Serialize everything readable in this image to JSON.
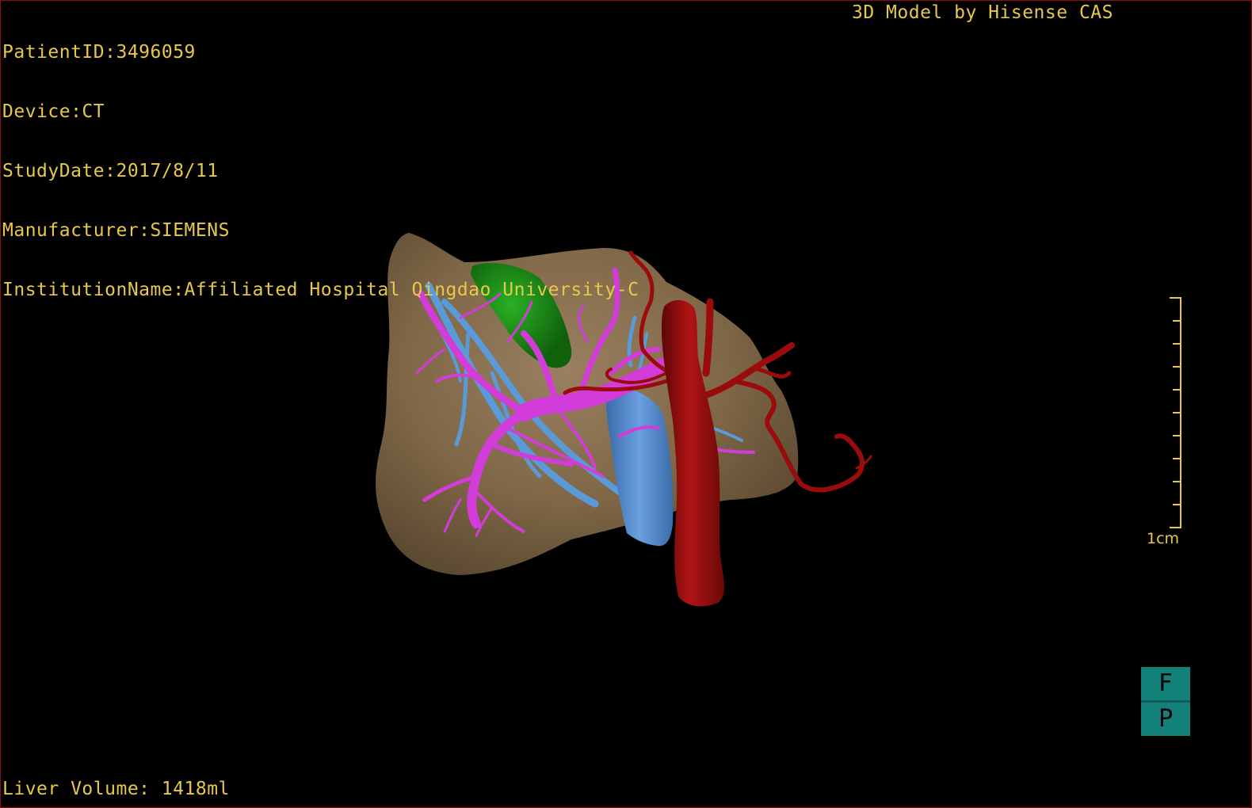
{
  "overlay": {
    "patient_id": "PatientID:3496059",
    "device": "Device:CT",
    "study_date": "StudyDate:2017/8/11",
    "manufacturer": "Manufacturer:SIEMENS",
    "institution": "InstitutionName:Affiliated Hospital Qingdao University-C",
    "brand_line": "3D Model by Hisense CAS",
    "liver_volume": "Liver Volume: 1418ml"
  },
  "scale_bar": {
    "label": "1cm"
  },
  "orientation": {
    "top": "F",
    "bottom": "P"
  },
  "logo": {
    "text": "Hisense"
  },
  "colors": {
    "text": "#e8c84a",
    "frame": "#8a1010",
    "liver": "#8a7250",
    "portal_vein": "#d23cd8",
    "hepatic_vein": "#5a9ad8",
    "ivc": "#4d84c8",
    "aorta": "#9a0c0c",
    "gallbladder": "#1e8a18",
    "brand": "#14938b"
  },
  "model_parts": [
    "liver",
    "gallbladder",
    "portal-vein",
    "hepatic-vein",
    "inferior-vena-cava",
    "artery"
  ]
}
